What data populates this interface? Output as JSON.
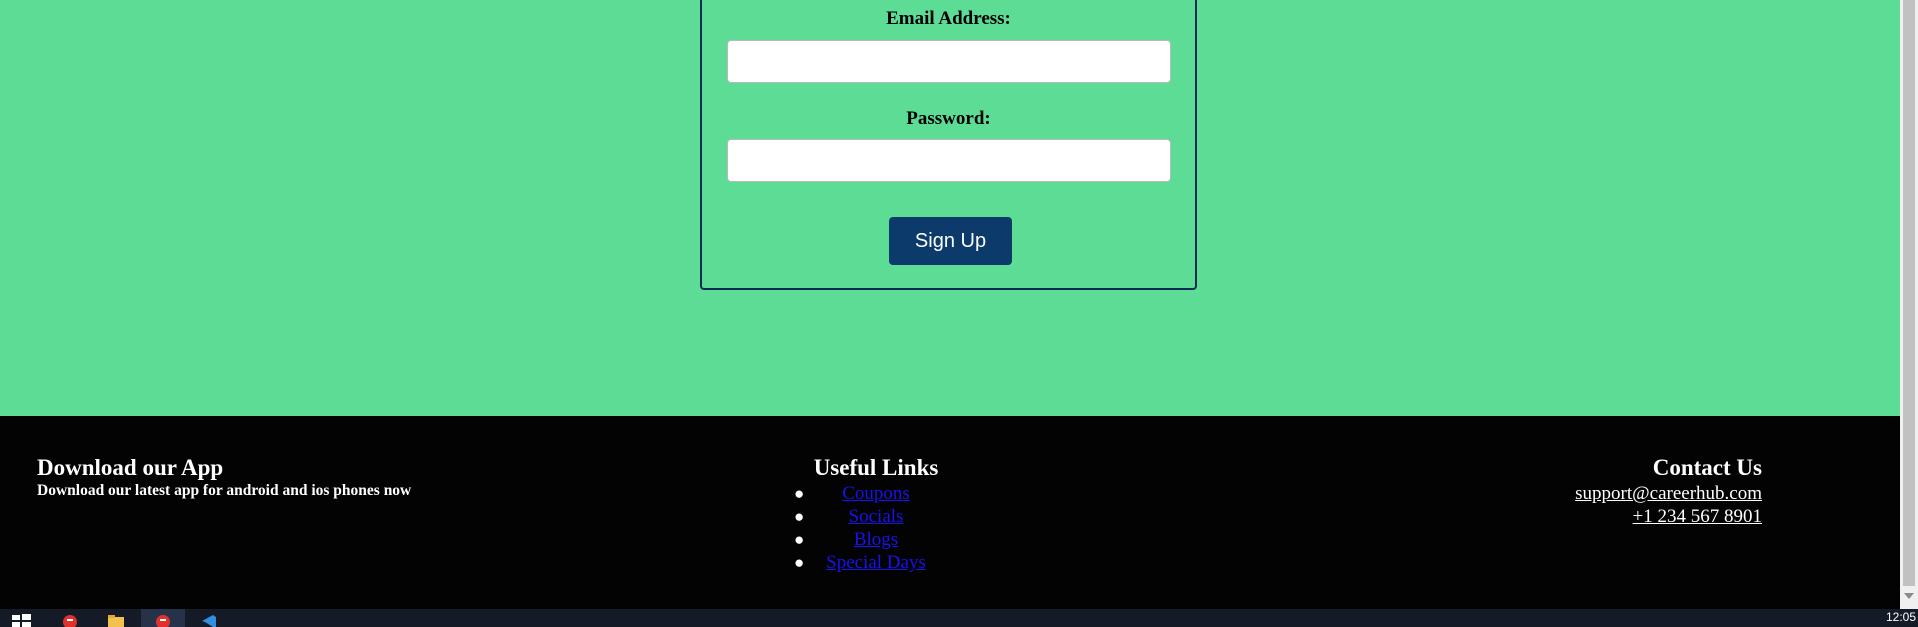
{
  "form": {
    "email_label": "Email Address:",
    "email_value": "",
    "password_label": "Password:",
    "password_value": "",
    "signup_label": "Sign Up"
  },
  "footer": {
    "app": {
      "title": "Download our App",
      "subtitle": "Download our latest app for android and ios phones now"
    },
    "links": {
      "title": "Useful Links",
      "items": [
        "Coupons",
        "Socials",
        "Blogs",
        "Special Days"
      ]
    },
    "contact": {
      "title": "Contact Us",
      "email": "support@careerhub.com",
      "phone": "+1 234 567 8901"
    }
  },
  "taskbar": {
    "clock": "12:05",
    "icons": [
      "windows-start-icon",
      "app-icon",
      "file-explorer-icon",
      "app-icon-active",
      "vscode-icon"
    ]
  },
  "colors": {
    "page_background": "#5cdc95",
    "form_border": "#0b2b55",
    "button": "#0b3a6b",
    "footer_background": "#030303",
    "link": "#1a10f0",
    "taskbar": "#141a26"
  }
}
